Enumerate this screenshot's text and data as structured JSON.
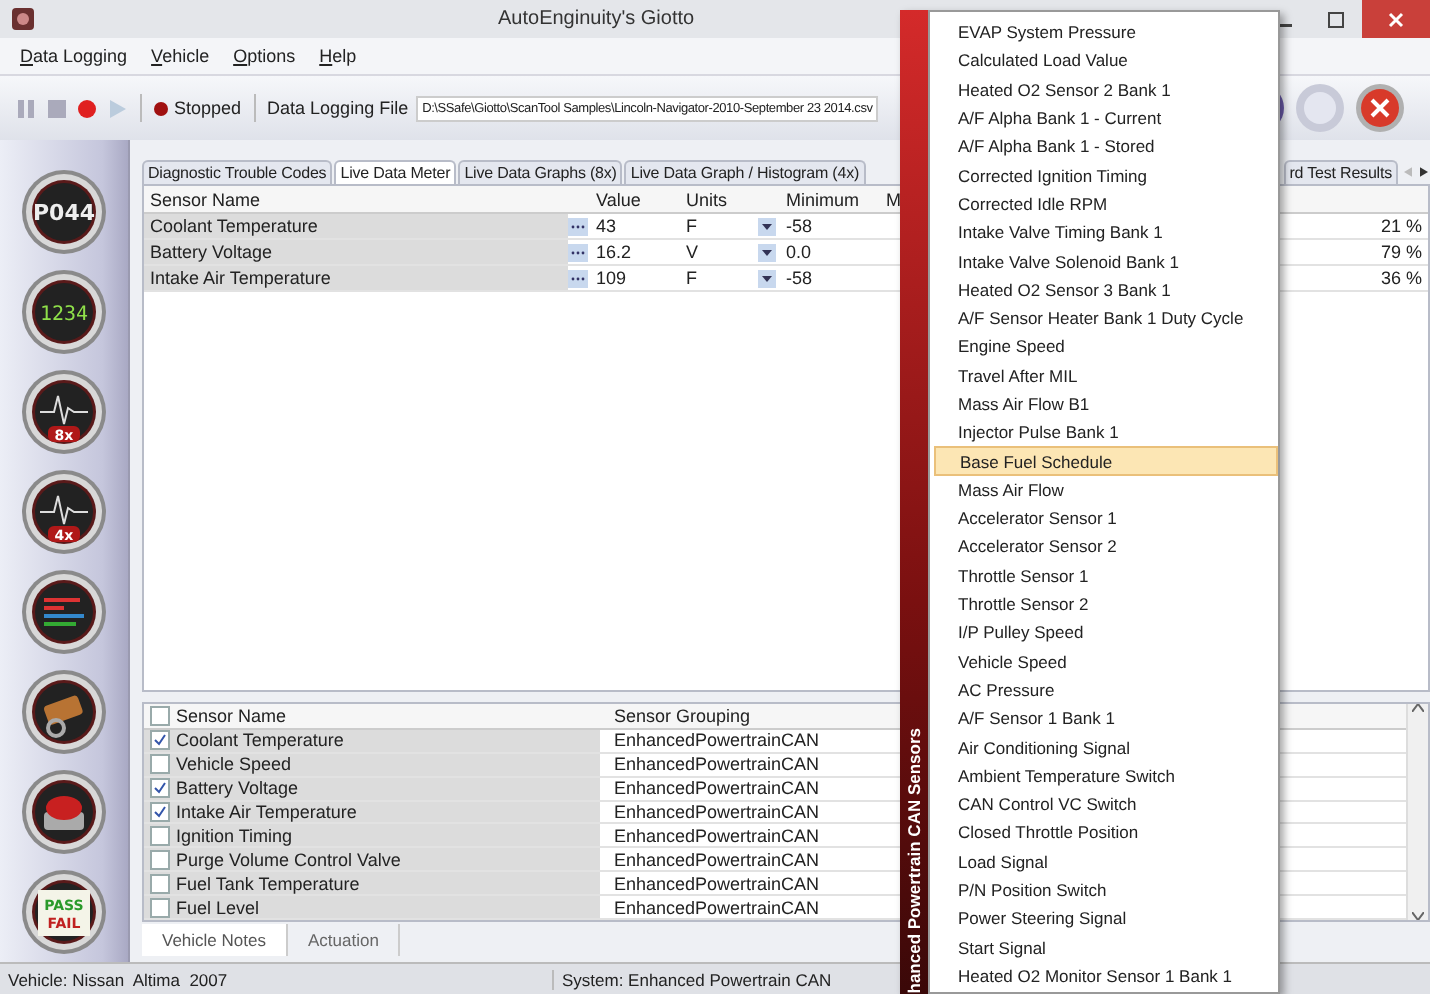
{
  "window": {
    "title": "AutoEnginuity's Giotto"
  },
  "menu_bar": [
    "Data Logging",
    "Vehicle",
    "Options",
    "Help"
  ],
  "toolbar": {
    "status": "Stopped",
    "file_label": "Data Logging File",
    "file_path": "D:\\SSafe\\Giotto\\ScanTool Samples\\Lincoln-Navigator-2010-September 23 2014.csv"
  },
  "sidebar": [
    {
      "kind": "dtc",
      "texts": [
        "P044"
      ]
    },
    {
      "kind": "digits",
      "texts": [
        "1234"
      ]
    },
    {
      "kind": "graph",
      "texts": [
        "8x"
      ]
    },
    {
      "kind": "graph",
      "texts": [
        "4x"
      ]
    },
    {
      "kind": "bars"
    },
    {
      "kind": "sensor"
    },
    {
      "kind": "stop"
    },
    {
      "kind": "passfail",
      "texts": [
        "PASS",
        "FAIL"
      ]
    }
  ],
  "tabs": [
    {
      "label": "Diagnostic Trouble Codes",
      "selected": false
    },
    {
      "label": "Live Data Meter",
      "selected": true
    },
    {
      "label": "Live Data Graphs (8x)",
      "selected": false
    },
    {
      "label": "Live Data Graph / Histogram (4x)",
      "selected": false
    },
    {
      "label": "rd Test Results",
      "selected": false
    }
  ],
  "meter_table": {
    "columns": [
      "Sensor Name",
      "Value",
      "Units",
      "Minimum",
      "M"
    ],
    "rows": [
      {
        "sensor": "Coolant Temperature",
        "value": "43",
        "units": "F",
        "minimum": "-58",
        "percent": "21 %"
      },
      {
        "sensor": "Battery Voltage",
        "value": "16.2",
        "units": "V",
        "minimum": "0.0",
        "percent": "79 %"
      },
      {
        "sensor": "Intake Air Temperature",
        "value": "109",
        "units": "F",
        "minimum": "-58",
        "percent": "36 %"
      }
    ]
  },
  "sensor_list": {
    "columns": [
      "Sensor Name",
      "Sensor Grouping"
    ],
    "all_checked": false,
    "rows": [
      {
        "name": "Coolant Temperature",
        "grouping": "EnhancedPowertrainCAN",
        "checked": true
      },
      {
        "name": "Vehicle Speed",
        "grouping": "EnhancedPowertrainCAN",
        "checked": false
      },
      {
        "name": "Battery Voltage",
        "grouping": "EnhancedPowertrainCAN",
        "checked": true
      },
      {
        "name": "Intake Air Temperature",
        "grouping": "EnhancedPowertrainCAN",
        "checked": true
      },
      {
        "name": "Ignition Timing",
        "grouping": "EnhancedPowertrainCAN",
        "checked": false
      },
      {
        "name": "Purge Volume Control Valve",
        "grouping": "EnhancedPowertrainCAN",
        "checked": false
      },
      {
        "name": "Fuel Tank Temperature",
        "grouping": "EnhancedPowertrainCAN",
        "checked": false
      },
      {
        "name": "Fuel Level",
        "grouping": "EnhancedPowertrainCAN",
        "checked": false
      }
    ]
  },
  "bottom_tabs": [
    {
      "label": "Vehicle Notes",
      "selected": true
    },
    {
      "label": "Actuation",
      "selected": false
    }
  ],
  "status_bar": {
    "vehicle": "Vehicle: Nissan  Altima  2007",
    "system": "System: Enhanced Powertrain CAN"
  },
  "popup_menu": {
    "title": "hanced Powertrain CAN Sensors",
    "items": [
      {
        "label": "EVAP System Pressure",
        "selected": false
      },
      {
        "label": "Calculated Load Value",
        "selected": false
      },
      {
        "label": "Heated O2 Sensor 2 Bank 1",
        "selected": false
      },
      {
        "label": "A/F Alpha Bank 1 - Current",
        "selected": false
      },
      {
        "label": "A/F Alpha Bank 1 - Stored",
        "selected": false
      },
      {
        "label": "Corrected Ignition Timing",
        "selected": false
      },
      {
        "label": "Corrected Idle RPM",
        "selected": false
      },
      {
        "label": "Intake Valve Timing Bank 1",
        "selected": false
      },
      {
        "label": "Intake Valve Solenoid Bank 1",
        "selected": false
      },
      {
        "label": "Heated O2 Sensor 3 Bank 1",
        "selected": false
      },
      {
        "label": "A/F Sensor Heater Bank 1 Duty Cycle",
        "selected": false
      },
      {
        "label": "Engine Speed",
        "selected": false
      },
      {
        "label": "Travel After MIL",
        "selected": false
      },
      {
        "label": "Mass Air Flow B1",
        "selected": false
      },
      {
        "label": "Injector Pulse Bank 1",
        "selected": false
      },
      {
        "label": "Base Fuel Schedule",
        "selected": true
      },
      {
        "label": "Mass Air Flow",
        "selected": false
      },
      {
        "label": "Accelerator Sensor 1",
        "selected": false
      },
      {
        "label": "Accelerator Sensor 2",
        "selected": false
      },
      {
        "label": "Throttle Sensor 1",
        "selected": false
      },
      {
        "label": "Throttle Sensor 2",
        "selected": false
      },
      {
        "label": "I/P Pulley Speed",
        "selected": false
      },
      {
        "label": "Vehicle Speed",
        "selected": false
      },
      {
        "label": "AC Pressure",
        "selected": false
      },
      {
        "label": "A/F Sensor 1 Bank 1",
        "selected": false
      },
      {
        "label": "Air Conditioning Signal",
        "selected": false
      },
      {
        "label": "Ambient Temperature Switch",
        "selected": false
      },
      {
        "label": "CAN Control VC Switch",
        "selected": false
      },
      {
        "label": "Closed Throttle Position",
        "selected": false
      },
      {
        "label": "Load Signal",
        "selected": false
      },
      {
        "label": "P/N Position Switch",
        "selected": false
      },
      {
        "label": "Power Steering Signal",
        "selected": false
      },
      {
        "label": "Start Signal",
        "selected": false
      },
      {
        "label": "Heated O2 Monitor Sensor 1 Bank 1",
        "selected": false
      }
    ]
  }
}
